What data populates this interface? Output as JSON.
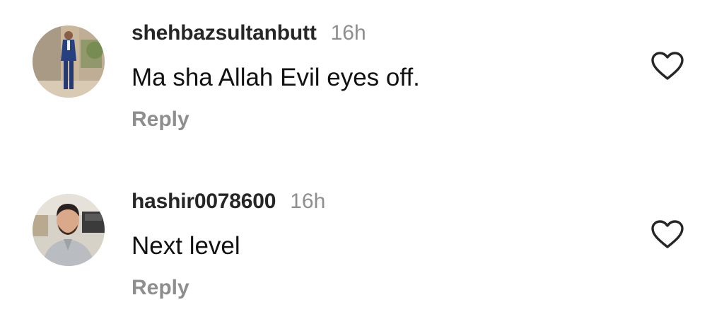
{
  "comments": [
    {
      "username": "shehbazsultanbutt",
      "time": "16h",
      "text": "Ma sha Allah Evil eyes off.",
      "reply_label": "Reply",
      "avatar_icon": "avatar-photo-man-in-blue-suit",
      "like_icon": "heart-outline-icon"
    },
    {
      "username": "hashir0078600",
      "time": "16h",
      "text": "Next level",
      "reply_label": "Reply",
      "avatar_icon": "avatar-photo-man-with-beard",
      "like_icon": "heart-outline-icon"
    }
  ],
  "colors": {
    "username": "#262626",
    "muted": "#8e8e8e",
    "text": "#111111",
    "background": "#ffffff"
  }
}
